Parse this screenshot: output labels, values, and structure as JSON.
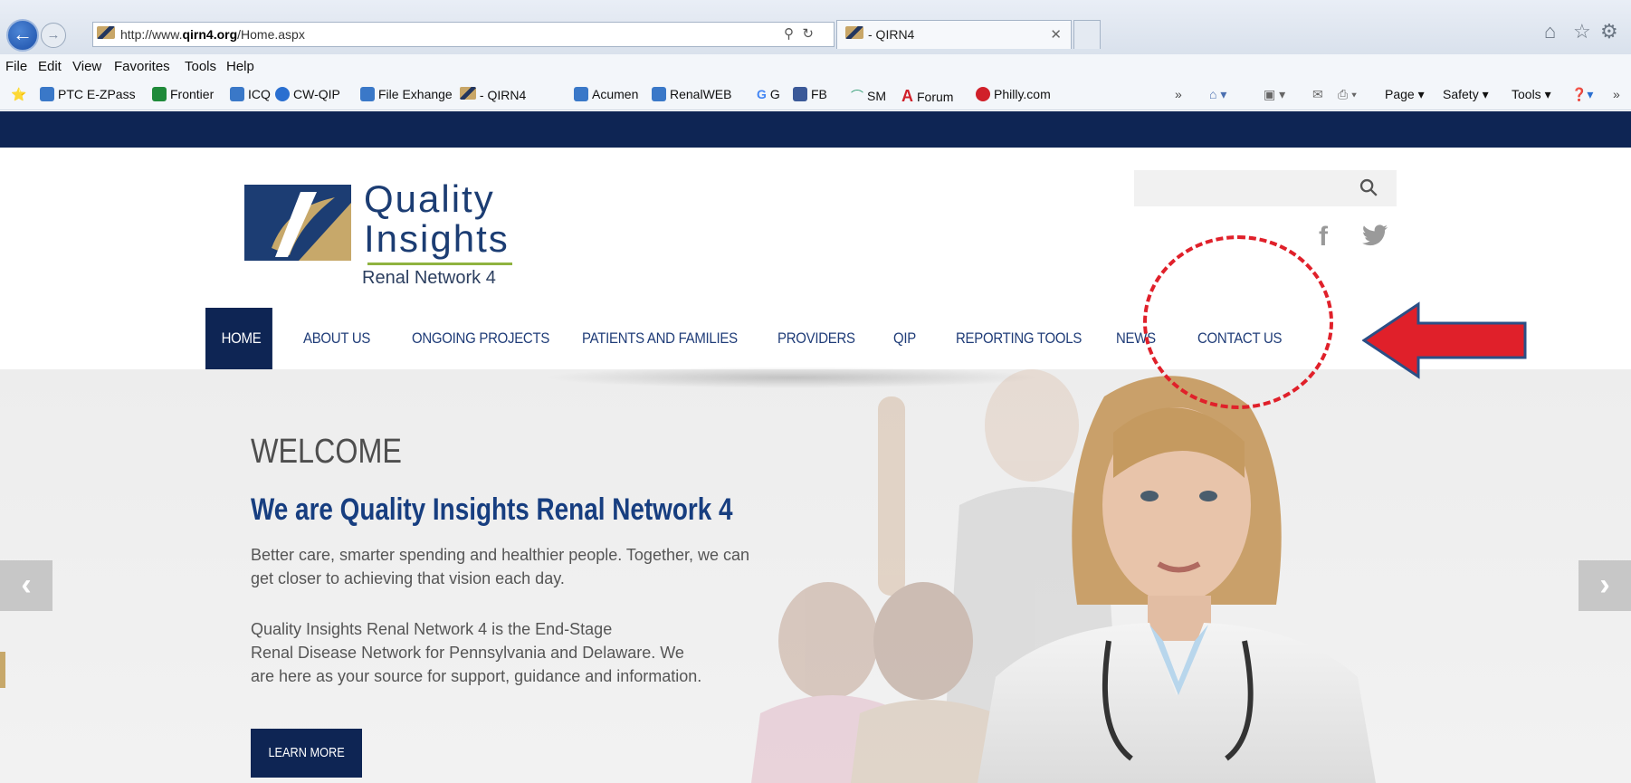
{
  "browser": {
    "url_prefix": "http://www.",
    "url_domain": "qirn4.org",
    "url_path": "/Home.aspx",
    "tab_title": "- QIRN4",
    "menu": [
      "File",
      "Edit",
      "View",
      "Favorites",
      "Tools",
      "Help"
    ],
    "favorites": [
      {
        "label": "PTC E-ZPass",
        "color": "#3a78c8"
      },
      {
        "label": "Frontier",
        "color": "#1f8a3a"
      },
      {
        "label": "ICQ",
        "color": "#3a78c8"
      },
      {
        "label": "CW-QIP",
        "color": "#2a6fd0"
      },
      {
        "label": "File Exhange",
        "color": "#3a78c8"
      },
      {
        "label": "- QIRN4",
        "color": "#c8a667"
      },
      {
        "label": "Acumen",
        "color": "#3a78c8"
      },
      {
        "label": "RenalWEB",
        "color": "#3a78c8"
      },
      {
        "label": "G",
        "color": "#ffffff"
      },
      {
        "label": "FB",
        "color": "#3b5998"
      },
      {
        "label": "SM",
        "color": "#3aa17a"
      },
      {
        "label": "Forum",
        "color": "#d0202a"
      },
      {
        "label": "Philly.com",
        "color": "#d0202a"
      }
    ],
    "commands": {
      "page": "Page ▾",
      "safety": "Safety ▾",
      "tools": "Tools ▾"
    }
  },
  "site": {
    "logo_line1": "Quality",
    "logo_line2": "Insights",
    "logo_tagline": "Renal Network 4",
    "social": {
      "facebook": "f",
      "twitter": "🐦"
    },
    "nav": [
      {
        "label": "HOME",
        "active": true
      },
      {
        "label": "ABOUT US"
      },
      {
        "label": "ONGOING PROJECTS"
      },
      {
        "label": "PATIENTS AND FAMILIES"
      },
      {
        "label": "PROVIDERS"
      },
      {
        "label": "QIP"
      },
      {
        "label": "REPORTING TOOLS"
      },
      {
        "label": "NEWS"
      },
      {
        "label": "CONTACT US"
      }
    ],
    "hero": {
      "heading": "WELCOME",
      "subheading": "We are Quality Insights Renal Network 4",
      "para1_line1": "Better care, smarter spending and healthier people. Together, we can",
      "para1_line2": "get closer to achieving that vision each day.",
      "para2_line1": "Quality Insights Renal Network 4 is the End-Stage",
      "para2_line2": "Renal Disease Network for Pennsylvania and Delaware. We",
      "para2_line3": "are here as your source for support, guidance and information.",
      "button": "LEARN MORE",
      "prev": "‹",
      "next": "›"
    }
  },
  "colors": {
    "navy": "#0e2554",
    "brand_blue": "#1c3d73",
    "gold": "#c7a86a",
    "green": "#8fb33f",
    "annotation_red": "#e0202a"
  },
  "icons": [
    "back-arrow-icon",
    "forward-arrow-icon",
    "search-icon",
    "refresh-icon",
    "close-icon",
    "home-icon",
    "star-icon",
    "gear-icon",
    "facebook-icon",
    "twitter-icon"
  ]
}
